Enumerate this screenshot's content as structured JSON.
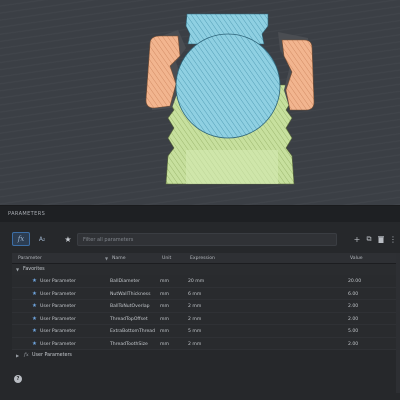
{
  "panel": {
    "title": "PARAMETERS",
    "fx_icon": "fx-icon",
    "sort_icon": "sort-az-icon",
    "favorites_icon": "star-icon",
    "search": {
      "placeholder": "Filter all parameters",
      "value": ""
    },
    "actions": [
      {
        "name": "add-icon",
        "glyph": "+"
      },
      {
        "name": "copy-icon",
        "glyph": "⧉"
      },
      {
        "name": "delete-icon",
        "glyph": "🗑"
      },
      {
        "name": "more-icon",
        "glyph": "⋮"
      }
    ],
    "columns": {
      "parameter": "Parameter",
      "name": "Name",
      "unit": "Unit",
      "expression": "Expression",
      "value": "Value"
    },
    "groups": {
      "favorites": "Favorites",
      "user_parameters": "User Parameters"
    },
    "rows": [
      {
        "type": "User Parameter",
        "name": "BallDiameter",
        "unit": "mm",
        "expression": "20 mm",
        "value": "20.00"
      },
      {
        "type": "User Parameter",
        "name": "NutWallThickness",
        "unit": "mm",
        "expression": "6 mm",
        "value": "6.00"
      },
      {
        "type": "User Parameter",
        "name": "BallToNutOverlap",
        "unit": "mm",
        "expression": "2 mm",
        "value": "2.00"
      },
      {
        "type": "User Parameter",
        "name": "ThreadTopOffset",
        "unit": "mm",
        "expression": "2 mm",
        "value": "2.00"
      },
      {
        "type": "User Parameter",
        "name": "ExtraBottomThread",
        "unit": "mm",
        "expression": "5 mm",
        "value": "5.00"
      },
      {
        "type": "User Parameter",
        "name": "ThreadToothSize",
        "unit": "mm",
        "expression": "2 mm",
        "value": "2.00"
      }
    ]
  },
  "colors": {
    "accent": "#3c6ea6",
    "ball": "#8fcfe0",
    "thread": "#c6df9c",
    "nut": "#f0b48f"
  }
}
